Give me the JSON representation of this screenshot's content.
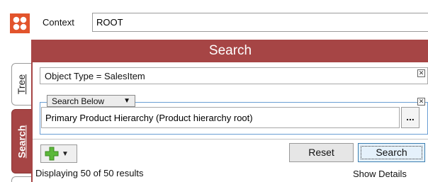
{
  "header": {
    "logo_icon": "app-logo-icon",
    "context_label": "Context",
    "context_value": "ROOT"
  },
  "tabs": [
    {
      "label": "Tree",
      "access_key": "T",
      "active": false
    },
    {
      "label": "Search",
      "access_key": "S",
      "active": true
    }
  ],
  "search_panel": {
    "title": "Search",
    "accent_color": "#a64545",
    "criteria": {
      "object_type_text": "Object Type = SalesItem",
      "remove_icon": "close-box-icon"
    },
    "search_below": {
      "select_label": "Search Below",
      "value": "Primary Product Hierarchy (Product hierarchy root)",
      "browse_label": "...",
      "remove_icon": "close-box-icon"
    },
    "add_button_icon": "green-plus-icon",
    "reset_label": "Reset",
    "search_label": "Search",
    "results_text": "Displaying 50 of 50 results",
    "show_details_label": "Show Details"
  }
}
